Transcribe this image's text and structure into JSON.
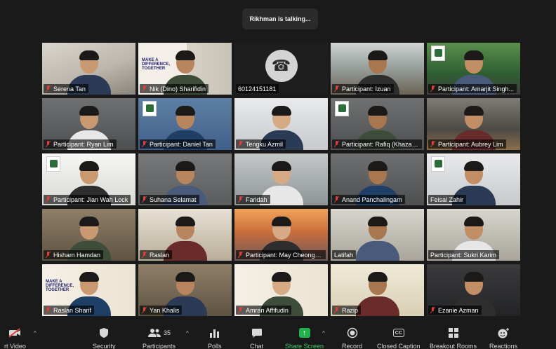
{
  "talking_banner": "Rikhman is talking...",
  "participants": [
    {
      "name": "Serena Tan",
      "bg": "office",
      "muted": true
    },
    {
      "name": "Nik (Dino) Sharifidin",
      "bg": "slide",
      "muted": true,
      "slide_text": "MAKE A DIFFERENCE, TOGETHER"
    },
    {
      "name": "60124151181",
      "bg": "black",
      "muted": false,
      "phone": true
    },
    {
      "name": "Participant: Izuan",
      "bg": "building",
      "muted": true
    },
    {
      "name": "Participant: Amarjit Singh...",
      "bg": "green",
      "muted": true
    },
    {
      "name": "Participant: Ryan Lim",
      "bg": "grey",
      "muted": true
    },
    {
      "name": "Participant: Daniel Tan",
      "bg": "blue",
      "muted": true
    },
    {
      "name": "Tengku Azmil",
      "bg": "light",
      "muted": true
    },
    {
      "name": "Participant: Rafiq (Khazan...",
      "bg": "grey",
      "muted": true
    },
    {
      "name": "Participant: Aubrey Lim",
      "bg": "atrium",
      "muted": true
    },
    {
      "name": "Participant: Jian Wah Lock",
      "bg": "white",
      "muted": true
    },
    {
      "name": "Suhana Selamat",
      "bg": "concrete",
      "muted": true
    },
    {
      "name": "Faridah",
      "bg": "windows",
      "muted": true
    },
    {
      "name": "Anand Panchalingam",
      "bg": "grey",
      "muted": true
    },
    {
      "name": "Feisal Zahir",
      "bg": "light",
      "muted": false
    },
    {
      "name": "Hisham Hamdan",
      "bg": "shelf",
      "muted": true
    },
    {
      "name": "Raslan",
      "bg": "room",
      "muted": true
    },
    {
      "name": "Participant: May Cheong -...",
      "bg": "sunset",
      "muted": true
    },
    {
      "name": "Latifah",
      "bg": "studio",
      "muted": false
    },
    {
      "name": "Participant: Sukri Karim",
      "bg": "studio",
      "muted": false
    },
    {
      "name": "Raslan Sharif",
      "bg": "slide2",
      "muted": true,
      "slide_text": "MAKE A DIFFERENCE, TOGETHER"
    },
    {
      "name": "Yan Khalis",
      "bg": "shelf",
      "muted": true
    },
    {
      "name": "Amran Affifudin",
      "bg": "slide2",
      "muted": true
    },
    {
      "name": "Razip",
      "bg": "cream",
      "muted": true
    },
    {
      "name": "Ezanie Azman",
      "bg": "dark",
      "muted": true
    }
  ],
  "toolbar": {
    "video": {
      "label": "rt Video",
      "icon": "video-off-icon"
    },
    "security": {
      "label": "Security",
      "icon": "shield-icon"
    },
    "participants": {
      "label": "Participants",
      "count": "35",
      "icon": "people-icon"
    },
    "polls": {
      "label": "Polls",
      "icon": "bar-chart-icon"
    },
    "chat": {
      "label": "Chat",
      "icon": "chat-bubble-icon"
    },
    "share": {
      "label": "Share Screen",
      "icon": "share-arrow-icon",
      "color": "#3fcf6a"
    },
    "record": {
      "label": "Record",
      "icon": "record-icon"
    },
    "cc": {
      "label": "Closed Caption",
      "icon_text": "CC"
    },
    "breakout": {
      "label": "Breakout Rooms",
      "icon": "grid-icon"
    },
    "reactions": {
      "label": "Reactions",
      "icon": "smiley-plus-icon"
    }
  }
}
